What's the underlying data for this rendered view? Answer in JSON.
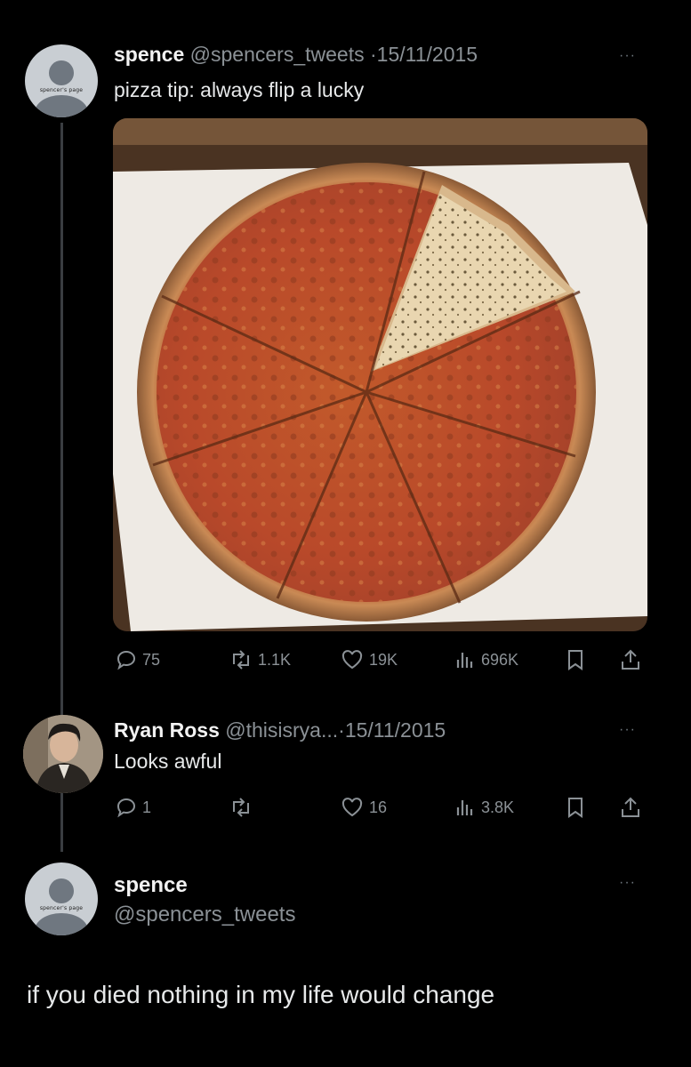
{
  "tweet1": {
    "display_name": "spence",
    "handle": "@spencers_tweets",
    "separator": "·",
    "date": "15/11/2015",
    "text": "pizza tip: always flip a lucky",
    "avatar_tag": "spencer's page",
    "more": "···",
    "stats": {
      "replies": "75",
      "reposts": "1.1K",
      "likes": "19K",
      "views": "696K"
    }
  },
  "tweet2": {
    "display_name": "Ryan Ross",
    "handle": "@thisisrya...",
    "separator": "·",
    "date": "15/11/2015",
    "text": "Looks awful",
    "more": "···",
    "stats": {
      "replies": "1",
      "reposts": "",
      "likes": "16",
      "views": "3.8K"
    }
  },
  "tweet3": {
    "display_name": "spence",
    "handle": "@spencers_tweets",
    "avatar_tag": "spencer's page",
    "more": "···",
    "text": "if you died nothing in my life would change"
  },
  "icons": [
    "reply-icon",
    "repost-icon",
    "like-icon",
    "views-icon",
    "bookmark-icon",
    "share-icon",
    "more-icon"
  ],
  "colors": {
    "background": "#000000",
    "text": "#e7e9ea",
    "muted": "#8b9196",
    "thread_line": "#3a3d41"
  }
}
